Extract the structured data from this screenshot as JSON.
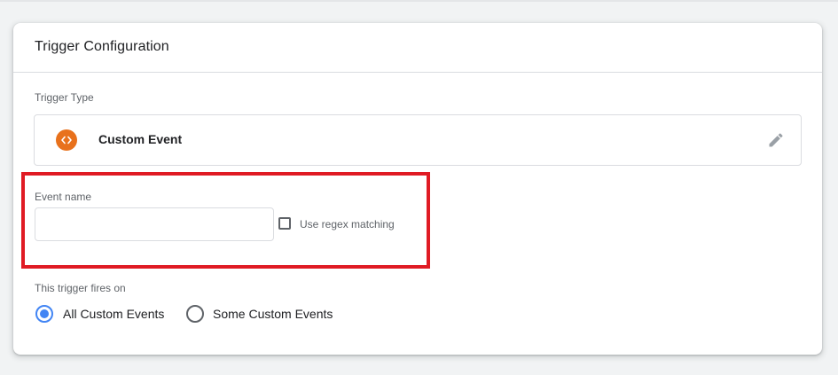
{
  "card": {
    "title": "Trigger Configuration"
  },
  "trigger_type": {
    "label": "Trigger Type",
    "name": "Custom Event",
    "icon": "code-brackets-icon",
    "icon_color": "#e8711c",
    "edit_icon": "pencil-icon"
  },
  "event_name": {
    "label": "Event name",
    "value": "",
    "placeholder": "",
    "regex_label": "Use regex matching",
    "regex_checked": false
  },
  "fires_on": {
    "label": "This trigger fires on",
    "options": [
      {
        "label": "All Custom Events",
        "selected": true
      },
      {
        "label": "Some Custom Events",
        "selected": false
      }
    ],
    "accent_color": "#4285f4"
  },
  "highlight_color": "#e01b24"
}
